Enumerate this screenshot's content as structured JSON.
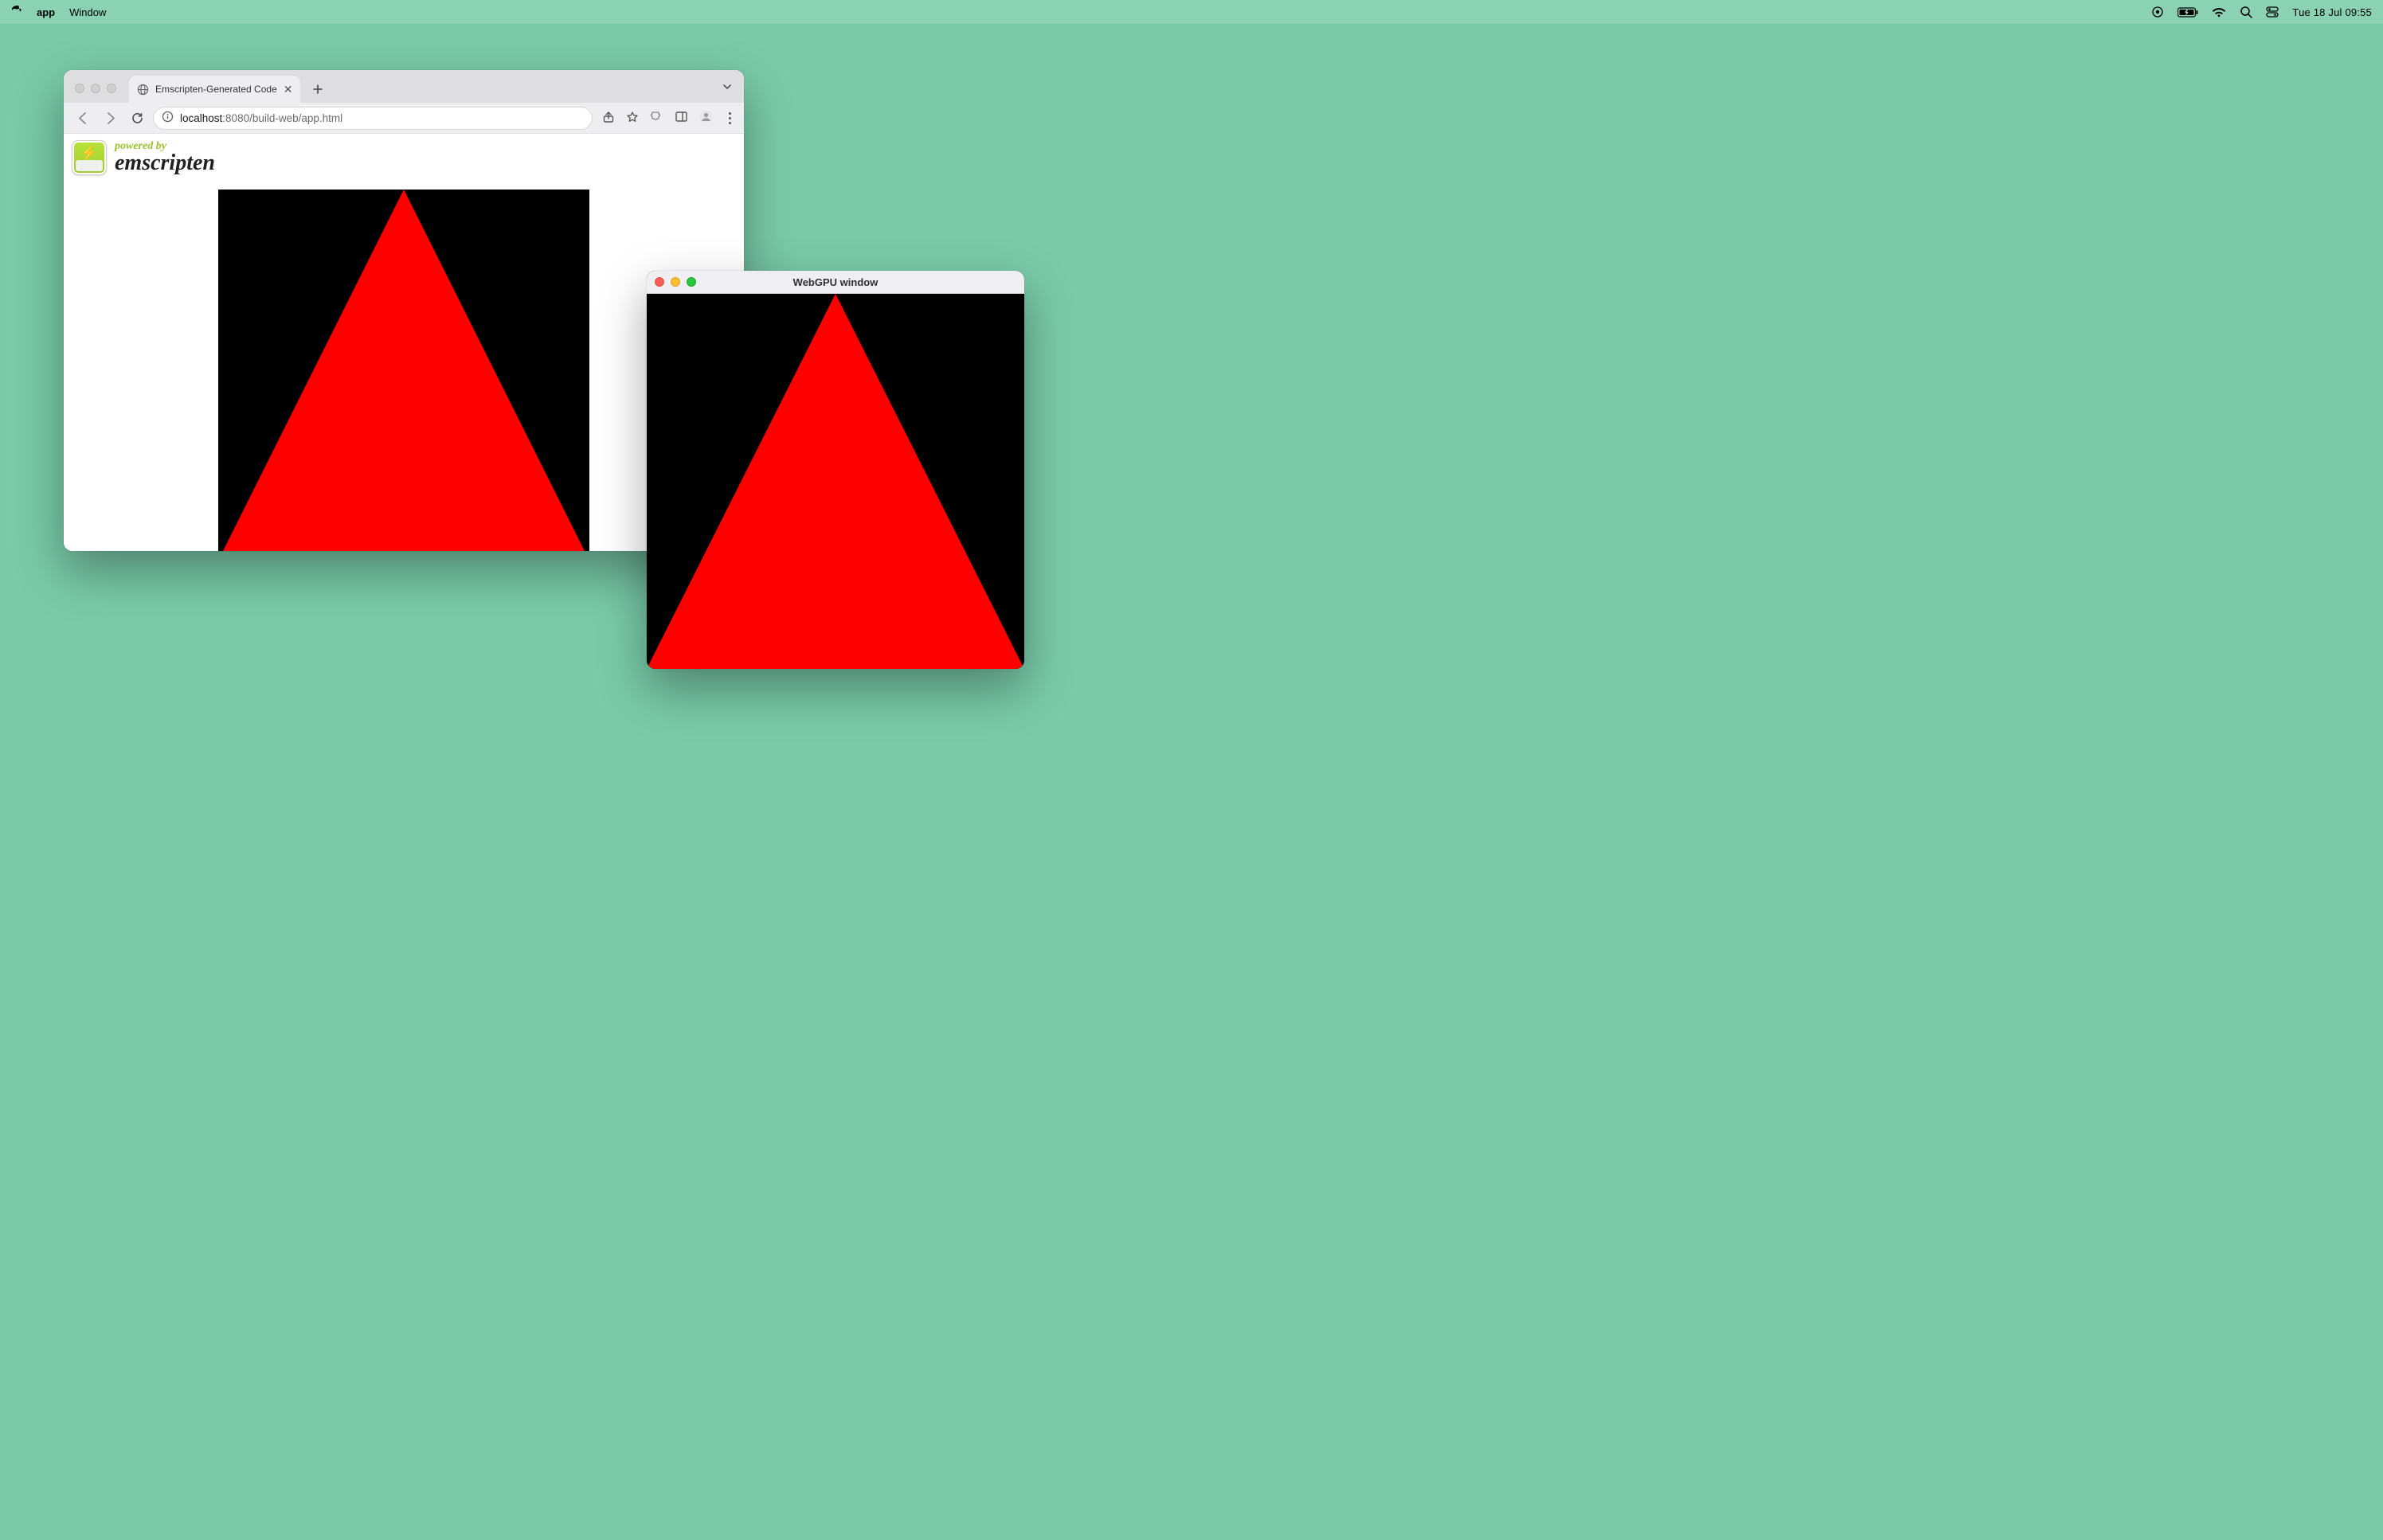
{
  "menubar": {
    "app_name": "app",
    "menus": [
      "Window"
    ],
    "clock": "Tue 18 Jul  09:55"
  },
  "browser": {
    "tab_title": "Emscripten-Generated Code",
    "url_host": "localhost",
    "url_rest": ":8080/build-web/app.html",
    "header": {
      "powered_by": "powered by",
      "brand": "emscripten"
    },
    "canvas": {
      "bg": "#000000",
      "triangle_fill": "#ff0000"
    }
  },
  "native": {
    "title": "WebGPU window",
    "canvas": {
      "bg": "#000000",
      "triangle_fill": "#ff0000"
    }
  }
}
